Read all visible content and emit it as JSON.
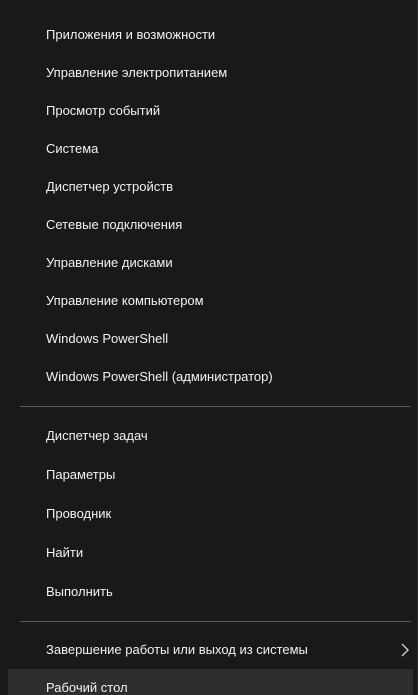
{
  "menu": {
    "group1": [
      {
        "label": "Приложения и возможности"
      },
      {
        "label": "Управление электропитанием"
      },
      {
        "label": "Просмотр событий"
      },
      {
        "label": "Система"
      },
      {
        "label": "Диспетчер устройств"
      },
      {
        "label": "Сетевые подключения"
      },
      {
        "label": "Управление дисками"
      },
      {
        "label": "Управление компьютером"
      },
      {
        "label": "Windows PowerShell"
      },
      {
        "label": "Windows PowerShell (администратор)"
      }
    ],
    "group2": [
      {
        "label": "Диспетчер задач"
      },
      {
        "label": "Параметры"
      },
      {
        "label": "Проводник"
      },
      {
        "label": "Найти"
      },
      {
        "label": "Выполнить"
      }
    ],
    "group3": [
      {
        "label": "Завершение работы или выход из системы",
        "icon": "chevron-right-icon"
      },
      {
        "label": "Рабочий стол"
      }
    ]
  },
  "colors": {
    "background": "#191919",
    "text": "#f2f2f2",
    "separator": "#5a5a5a",
    "highlight": "#2e2e2e"
  }
}
